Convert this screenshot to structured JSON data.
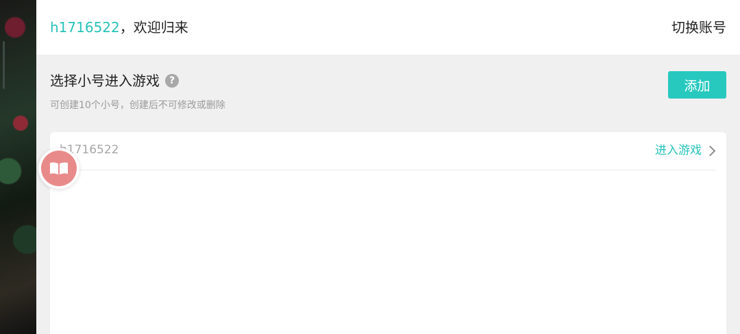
{
  "header": {
    "username": "h1716522",
    "welcome_suffix": "，欢迎归来",
    "switch_account_label": "切换账号"
  },
  "section": {
    "title": "选择小号进入游戏",
    "help_icon_glyph": "?",
    "hint": "可创建10个小号，创建后不可修改或删除",
    "add_button_label": "添加"
  },
  "accounts": [
    {
      "name": "h1716522",
      "enter_label": "进入游戏"
    }
  ],
  "float_ball": {
    "icon": "book-icon"
  },
  "colors": {
    "accent": "#27c2ba",
    "button": "#27c9bf",
    "background": "#f0f0f0"
  }
}
